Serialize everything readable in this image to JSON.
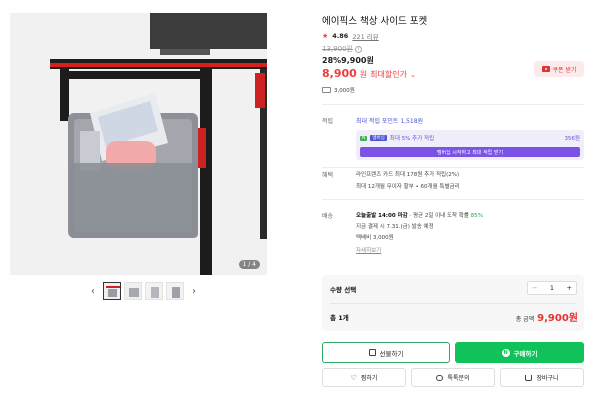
{
  "gallery": {
    "counter": "1 / 4",
    "thumb_count": 4,
    "prev_arrow": "‹",
    "next_arrow": "›"
  },
  "product": {
    "title": "에이픽스 책상 사이드 포켓",
    "rating": "4.86",
    "reviews": "221 리뷰",
    "original_price": "13,900원",
    "discount_line": "28%9,900원",
    "max_discount_price": "8,900",
    "max_discount_unit": "원",
    "max_discount_label": "최대할인가",
    "coupon_label": "쿠폰 받기",
    "shipping_fee": "3,000원"
  },
  "points": {
    "label": "적립",
    "line": "최대 적립 포인트 1,518원",
    "member_text": "최대 5% 추가 적립",
    "member_badge": "멤버십",
    "member_amount": "356원",
    "member_cta": "멤버십 시작하고 최대 적립 받기"
  },
  "benefits": {
    "label": "혜택",
    "line1": "라인프렌즈 카드 최대 178원 추가 적립(2%)",
    "line2": "최대 12개월 무이자 할부 • 60개월 특별금리"
  },
  "delivery": {
    "label": "배송",
    "line1_bold": "오늘출발 14:00 마감",
    "line1_rest": " · 평균 2일 이내 도착 확률 ",
    "line1_pct": "85%",
    "line2": "지금 결제 시 7.31.(금) 발송 예정",
    "line3": "택배비 3,000원",
    "more": "자세히보기"
  },
  "quantity": {
    "label": "수량 선택",
    "value": "1",
    "minus": "−",
    "plus": "+",
    "total_count": "총 1개",
    "total_label": "총 금액",
    "total_amount": "9,900원"
  },
  "actions": {
    "gift": "선물하기",
    "buy": "구매하기",
    "buy_badge": "N",
    "wish": "찜하기",
    "talk": "톡톡문의",
    "cart": "장바구니"
  },
  "colors": {
    "accent_red": "#f03c3c",
    "buy_green": "#11c25a",
    "member_purple": "#7b52e6"
  }
}
